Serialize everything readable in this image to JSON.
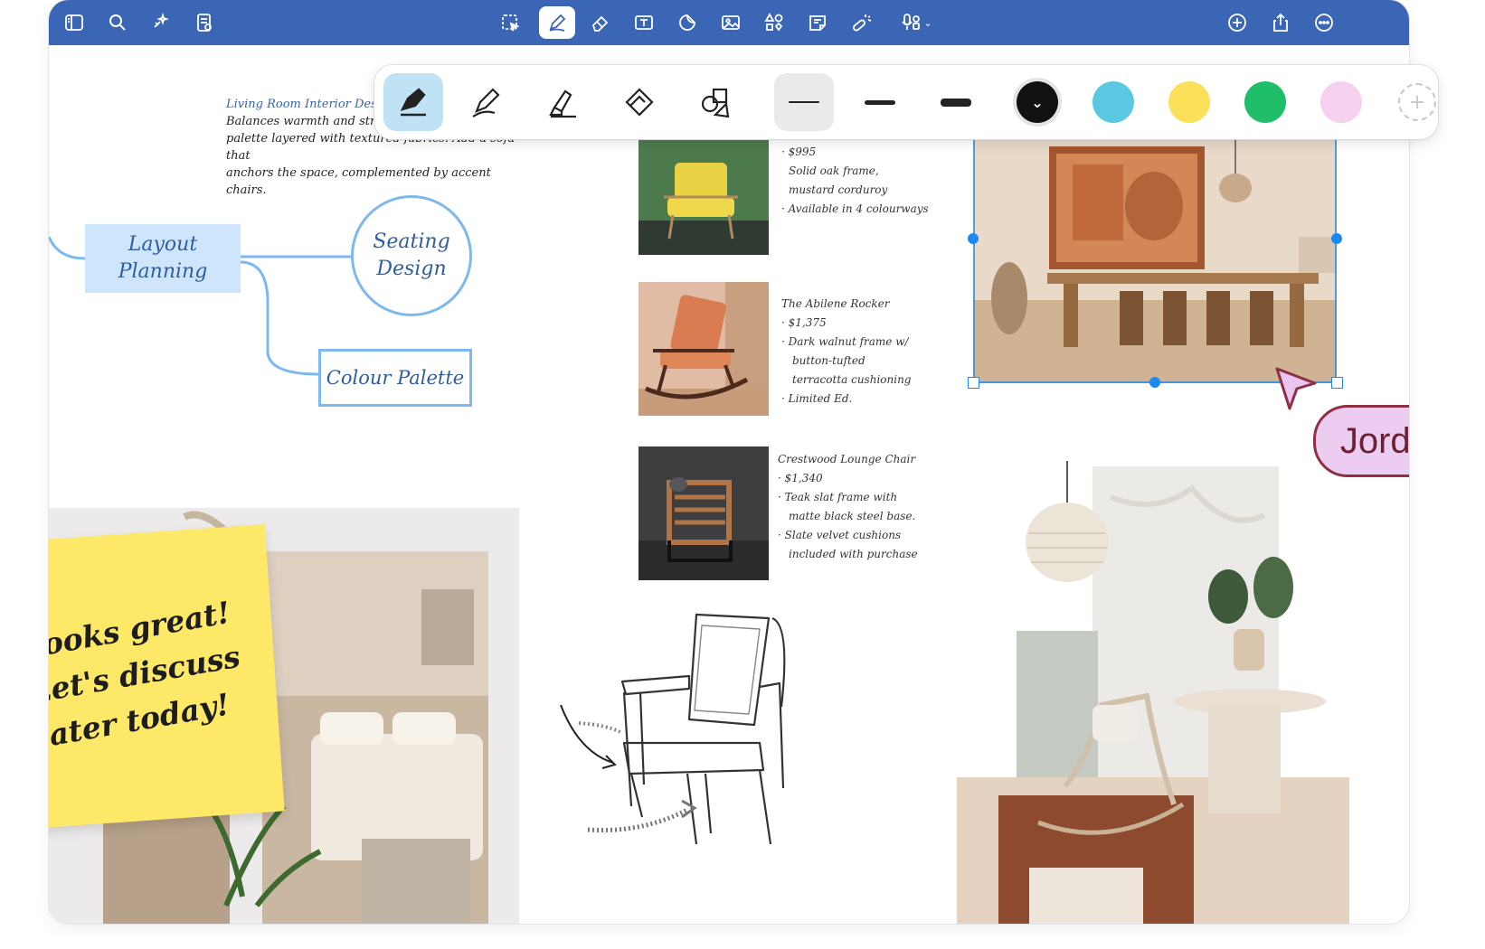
{
  "toolbar": {
    "left_icons": [
      "sidebar-icon",
      "search-icon",
      "sparkle-icon",
      "notes-icon"
    ],
    "center_tools": [
      "lasso-select-icon",
      "pen-tool-icon",
      "eraser-icon",
      "text-box-icon",
      "sticker-icon",
      "image-icon",
      "shapes-icon",
      "note-icon",
      "laser-pointer-icon",
      "record-audio-icon"
    ],
    "right_icons": [
      "add-page-icon",
      "share-icon",
      "more-icon"
    ],
    "bar_color": "#3b65b5"
  },
  "pen_toolbar": {
    "tools": [
      "fountain-pen",
      "ball-pen",
      "highlighter",
      "eraser",
      "shape"
    ],
    "strokes": [
      "thin",
      "medium",
      "thick"
    ],
    "colors": [
      "#111111",
      "#5bc8e2",
      "#fbe15a",
      "#1fbf6a",
      "#f6d0ef"
    ],
    "active_color": "#111111"
  },
  "canvas": {
    "notes": {
      "title": "Living Room Interior Desi",
      "line1": "Balances warmth and str",
      "line2": "palette layered with textured fabrics. Add a sofa that",
      "line3": "anchors the space, complemented by accent chairs."
    },
    "mind_map": {
      "layout_line1": "Layout",
      "layout_line2": "Planning",
      "seating_line1": "Seating",
      "seating_line2": "Design",
      "colour": "Colour Palette"
    },
    "products": [
      {
        "price": "· $995",
        "line1": "Solid oak frame,",
        "line2": "mustard corduroy",
        "line3": "· Available in 4 colourways"
      },
      {
        "name": "The Abilene Rocker",
        "price": "· $1,375",
        "line1": "· Dark walnut frame w/",
        "line2": "button-tufted",
        "line3": "terracotta cushioning",
        "line4": "· Limited Ed."
      },
      {
        "name": "Crestwood Lounge Chair",
        "price": "· $1,340",
        "line1": "· Teak slat frame with",
        "line2": "matte black steel base.",
        "line3": "· Slate velvet cushions",
        "line4": "included with purchase"
      }
    ],
    "sticky_note": {
      "line1": "Looks great!",
      "line2": "Let's discuss",
      "line3": "later today!"
    },
    "collaborator": {
      "name": "Jordan",
      "color": "#8e2f43"
    }
  }
}
